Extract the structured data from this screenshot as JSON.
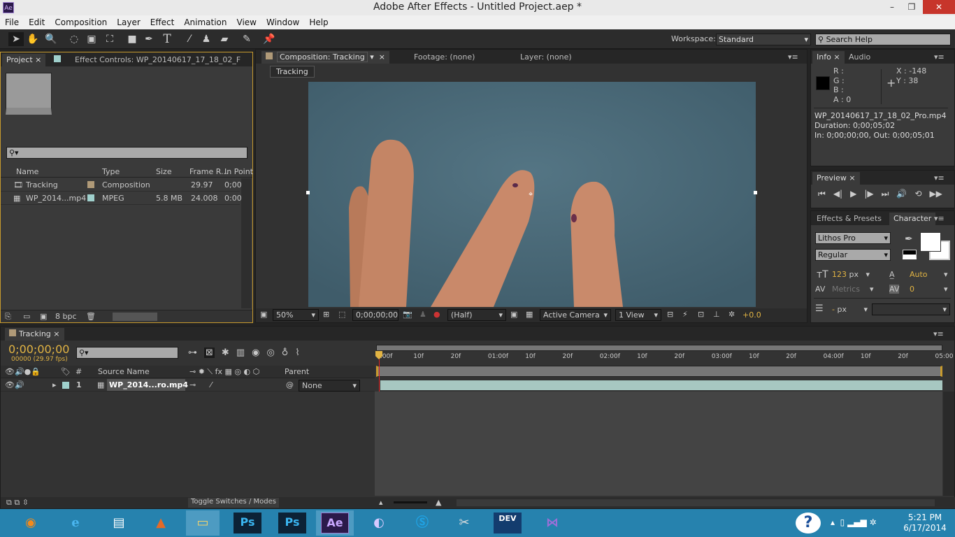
{
  "window": {
    "title": "Adobe After Effects - Untitled Project.aep *",
    "logo": "Ae",
    "minimize": "–",
    "restore": "❐",
    "close": "✕"
  },
  "menu": [
    "File",
    "Edit",
    "Composition",
    "Layer",
    "Effect",
    "Animation",
    "View",
    "Window",
    "Help"
  ],
  "toolbar": {
    "workspace_label": "Workspace:",
    "workspace_value": "Standard",
    "search_placeholder": "Search Help"
  },
  "project": {
    "tab": "Project",
    "effect_tab": "Effect Controls: WP_20140617_17_18_02_F",
    "columns": [
      "Name",
      "Type",
      "Size",
      "Frame R...",
      "In Point"
    ],
    "items": [
      {
        "name": "Tracking",
        "color": "#b09a78",
        "type": "Composition",
        "size": "",
        "fps": "29.97",
        "in": "0;00"
      },
      {
        "name": "WP_2014...mp4",
        "color": "#9fd0cc",
        "type": "MPEG",
        "size": "5.8 MB",
        "fps": "24.008",
        "in": "0:00"
      }
    ],
    "bpc": "8 bpc"
  },
  "composition": {
    "tab": "Composition: Tracking",
    "footage_tab": "Footage: (none)",
    "layer_tab": "Layer: (none)",
    "breadcrumb": "Tracking",
    "zoom": "50%",
    "timecode": "0;00;00;00",
    "resolution": "(Half)",
    "camera": "Active Camera",
    "views": "1 View",
    "exposure": "+0.0"
  },
  "info": {
    "tab": "Info",
    "audio_tab": "Audio",
    "r": "R :",
    "g": "G :",
    "b": "B :",
    "a": "A : 0",
    "x": "X : -148",
    "y": "Y : 38",
    "file": "WP_20140617_17_18_02_Pro.mp4",
    "duration": "Duration: 0;00;05;02",
    "inout": "In: 0;00;00;00, Out: 0;00;05;01"
  },
  "preview": {
    "tab": "Preview"
  },
  "character": {
    "effects_tab": "Effects & Presets",
    "tab": "Character",
    "font": "Lithos Pro",
    "style": "Regular",
    "size": "123",
    "size_unit": "px",
    "leading": "Auto",
    "kerning": "Metrics",
    "tracking": "0",
    "stroke": "-",
    "stroke_unit": "px"
  },
  "timeline": {
    "tab": "Tracking",
    "timecode": "0;00;00;00",
    "frames": "00000 (29.97 fps)",
    "columns": {
      "num": "#",
      "source": "Source Name",
      "parent": "Parent"
    },
    "layer": {
      "num": "1",
      "name": "WP_2014...ro.mp4",
      "parent": "None",
      "color": "#9fd0cc"
    },
    "ruler": [
      "0:00f",
      "10f",
      "20f",
      "01:00f",
      "10f",
      "20f",
      "02:00f",
      "10f",
      "20f",
      "03:00f",
      "10f",
      "20f",
      "04:00f",
      "10f",
      "20f",
      "05:00"
    ],
    "toggle": "Toggle Switches / Modes"
  },
  "taskbar": {
    "apps": [
      "firefox",
      "ie",
      "finder",
      "matlab",
      "explorer",
      "photoshop",
      "photoshop",
      "after-effects",
      "eclipse",
      "skype",
      "paint",
      "dev",
      "visual-studio"
    ],
    "labels": {
      "ps": "Ps",
      "ae": "Ae",
      "dev": "DEV"
    },
    "time": "5:21 PM",
    "date": "6/17/2014",
    "help": "?"
  }
}
